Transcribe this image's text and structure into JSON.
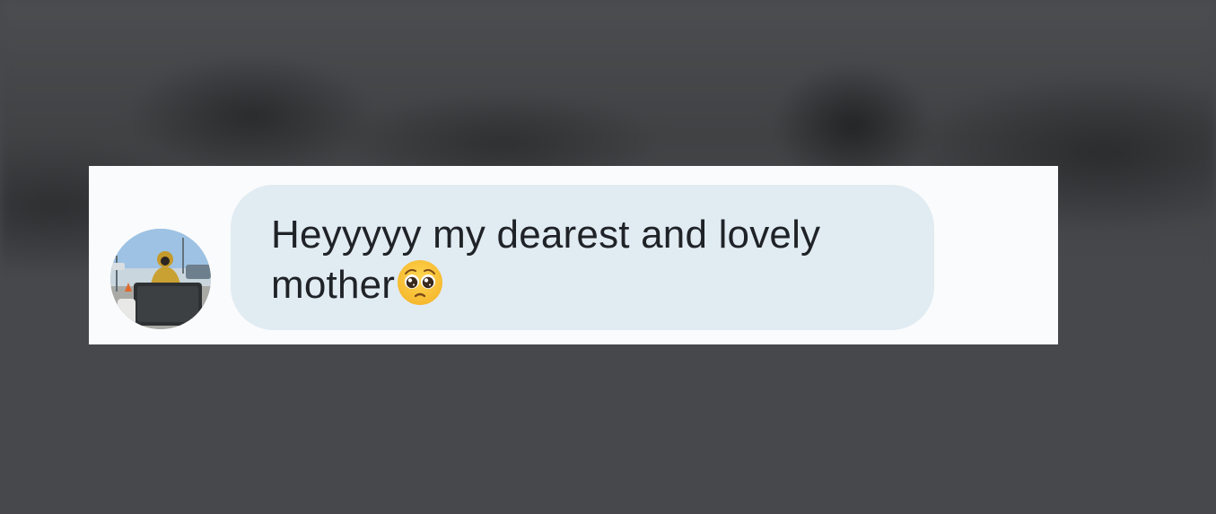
{
  "message": {
    "text": "Heyyyyy my dearest and lovely mother",
    "emoji": "pleading-face-emoji"
  },
  "colors": {
    "card_background": "#fafbfc",
    "bubble_background": "#e1ebf2",
    "text": "#1f2327",
    "page_background": "#47494c"
  }
}
